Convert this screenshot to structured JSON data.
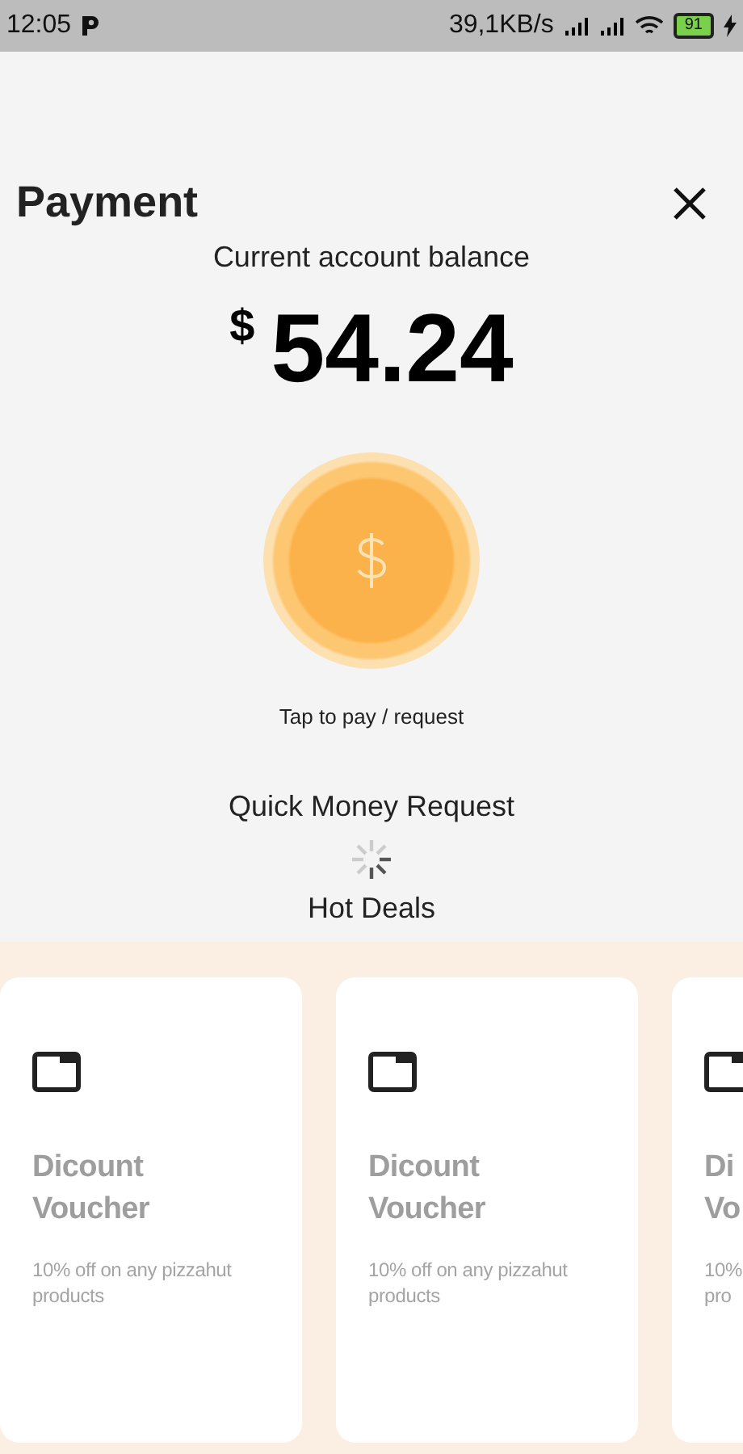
{
  "status_bar": {
    "time": "12:05",
    "network_speed": "39,1KB/s",
    "battery": "91"
  },
  "header": {
    "title": "Payment"
  },
  "balance": {
    "label": "Current account balance",
    "currency": "$",
    "amount": "54.24"
  },
  "pay_button": {
    "caption": "Tap to pay / request"
  },
  "quick_request": {
    "title": "Quick Money Request",
    "loading": true
  },
  "hot_deals": {
    "title": "Hot Deals",
    "cards": [
      {
        "title_lines": [
          "Dicount",
          "Voucher"
        ],
        "description_lines": [
          "10% off on any pizzahut",
          "products"
        ]
      },
      {
        "title_lines": [
          "Dicount",
          "Voucher"
        ],
        "description_lines": [
          "10% off on any pizzahut",
          "products"
        ]
      },
      {
        "title_lines": [
          "Di",
          "Vo"
        ],
        "description_lines": [
          "10%",
          "pro"
        ]
      }
    ]
  }
}
